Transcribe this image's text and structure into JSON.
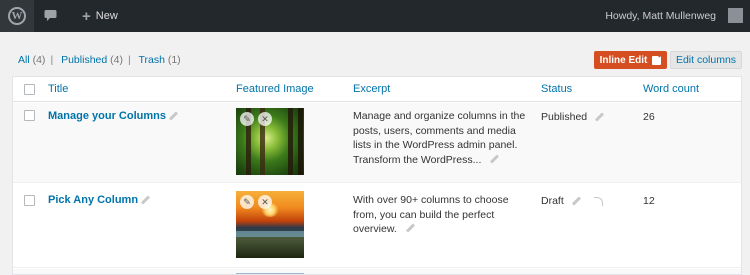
{
  "adminbar": {
    "new_label": "New",
    "howdy": "Howdy, Matt Mullenweg"
  },
  "filters": {
    "all_label": "All",
    "all_count": "(4)",
    "published_label": "Published",
    "published_count": "(4)",
    "trash_label": "Trash",
    "trash_count": "(1)"
  },
  "toolbar": {
    "inline_edit_label": "Inline Edit",
    "edit_columns_label": "Edit columns"
  },
  "table": {
    "headers": {
      "title": "Title",
      "featured_image": "Featured Image",
      "excerpt": "Excerpt",
      "status": "Status",
      "word_count": "Word count"
    },
    "rows": [
      {
        "title": "Manage your Columns",
        "excerpt": "Manage and organize columns in the posts, users, comments and media lists in the WordPress admin panel. Transform the WordPress...",
        "status": "Published",
        "word_count": "26",
        "image": "forest"
      },
      {
        "title": "Pick Any Column",
        "excerpt": "With over 90+ columns to choose from, you can build the perfect overview.",
        "status": "Draft",
        "word_count": "12",
        "image": "sunset"
      }
    ]
  },
  "colors": {
    "link": "#0073aa",
    "adminbar": "#23282d",
    "inline_edit_bg": "#d54e21"
  }
}
